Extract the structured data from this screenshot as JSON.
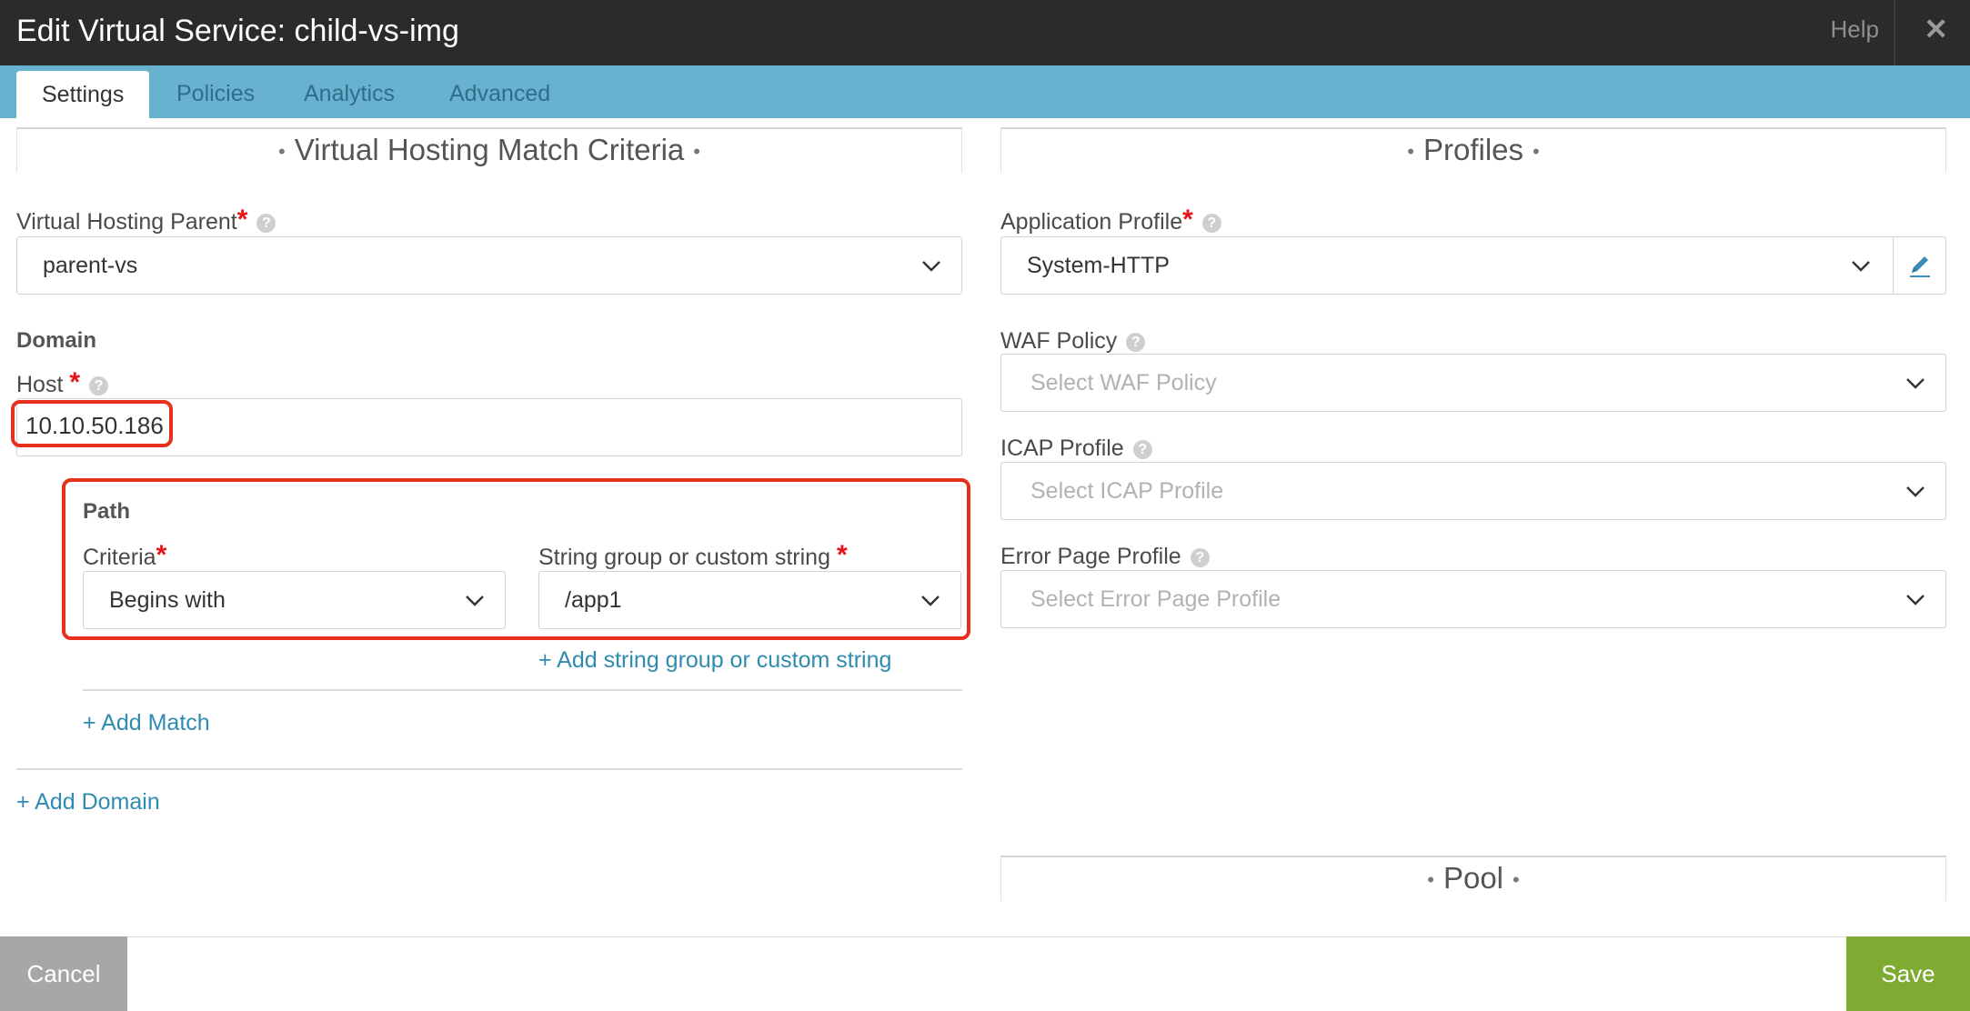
{
  "window": {
    "title": "Edit Virtual Service: child-vs-img",
    "help_label": "Help",
    "close_glyph": "✕"
  },
  "tabs": [
    {
      "label": "Settings",
      "active": true
    },
    {
      "label": "Policies",
      "active": false
    },
    {
      "label": "Analytics",
      "active": false
    },
    {
      "label": "Advanced",
      "active": false
    }
  ],
  "left": {
    "section_title": "Virtual Hosting Match Criteria",
    "vh_parent_label": "Virtual Hosting Parent",
    "vh_parent_value": "parent-vs",
    "domain_heading": "Domain",
    "host_label": "Host",
    "host_value": "10.10.50.186",
    "path_heading": "Path",
    "criteria_label": "Criteria",
    "criteria_value": "Begins with",
    "string_label": "String group or custom string",
    "string_value": "/app1",
    "add_string_link": "+ Add string group or custom string",
    "add_match_link": "+ Add Match",
    "add_domain_link": "+ Add Domain"
  },
  "right": {
    "section_title": "Profiles",
    "app_profile_label": "Application Profile",
    "app_profile_value": "System-HTTP",
    "waf_label": "WAF Policy",
    "waf_placeholder": "Select WAF Policy",
    "icap_label": "ICAP Profile",
    "icap_placeholder": "Select ICAP Profile",
    "error_label": "Error Page Profile",
    "error_placeholder": "Select Error Page Profile",
    "pool_section_title": "Pool"
  },
  "footer": {
    "cancel_label": "Cancel",
    "save_label": "Save"
  },
  "colors": {
    "titlebar": "#2b2b2b",
    "tabbar": "#68b1cf",
    "link": "#2f8bb0",
    "required": "#e8131a",
    "highlight": "#e62f1d",
    "save": "#7fab33",
    "cancel": "#a7a7a7"
  },
  "icons": [
    "question-icon",
    "chevron-down-icon",
    "pencil-icon",
    "close-icon"
  ]
}
